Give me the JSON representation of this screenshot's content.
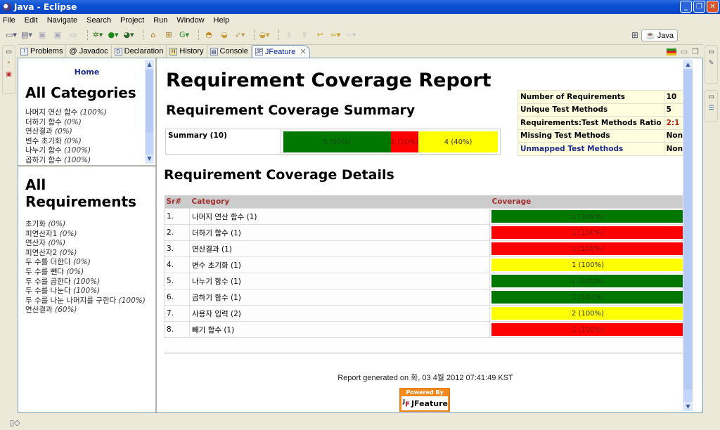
{
  "window": {
    "title": "Java - Eclipse"
  },
  "menu": [
    "File",
    "Edit",
    "Navigate",
    "Search",
    "Project",
    "Run",
    "Window",
    "Help"
  ],
  "perspective": {
    "label": "Java"
  },
  "tabs": [
    {
      "label": "Problems",
      "icon": "problems-icon",
      "active": false
    },
    {
      "label": "@ Javadoc",
      "icon": "javadoc-icon",
      "active": false
    },
    {
      "label": "Declaration",
      "icon": "declaration-icon",
      "active": false
    },
    {
      "label": "History",
      "icon": "history-icon",
      "active": false
    },
    {
      "label": "Console",
      "icon": "console-icon",
      "active": false
    },
    {
      "label": "JFeature",
      "icon": "jfeature-icon",
      "active": true
    }
  ],
  "sidebar": {
    "home_label": "Home",
    "categories_title": "All Categories",
    "categories": [
      {
        "name": "나머지 연산 함수",
        "pct": "(100%)"
      },
      {
        "name": "더하기 함수",
        "pct": "(0%)"
      },
      {
        "name": "연산결과",
        "pct": "(0%)"
      },
      {
        "name": "변수 초기화",
        "pct": "(0%)"
      },
      {
        "name": "나누기 함수",
        "pct": "(100%)"
      },
      {
        "name": "곱하기 함수",
        "pct": "(100%)"
      }
    ],
    "requirements_title_1": "All",
    "requirements_title_2": "Requirements",
    "requirements": [
      {
        "name": "초기화",
        "pct": "(0%)"
      },
      {
        "name": "피연산자1",
        "pct": "(0%)"
      },
      {
        "name": "연산자",
        "pct": "(0%)"
      },
      {
        "name": "피연산자2",
        "pct": "(0%)"
      },
      {
        "name": "두 수를 더한다",
        "pct": "(0%)"
      },
      {
        "name": "두 수를 뺀다",
        "pct": "(0%)"
      },
      {
        "name": "두 수를 곱한다",
        "pct": "(100%)"
      },
      {
        "name": "두 수를 나눈다",
        "pct": "(100%)"
      },
      {
        "name": "두 수를 나눈 나머지를 구한다",
        "pct": "(100%)"
      },
      {
        "name": "연산결과",
        "pct": "(60%)"
      }
    ]
  },
  "report": {
    "title": "Requirement Coverage Report",
    "summary_title": "Requirement Coverage Summary",
    "summary_label": "Summary (10)",
    "summary_segments": [
      {
        "label": "5 (50%)",
        "fraction": 0.5,
        "color": "#007700",
        "text_color": "#0a4a0a"
      },
      {
        "label": "1 (10%)",
        "fraction": 0.13,
        "color": "#ff0000",
        "text_color": "#8a0000"
      },
      {
        "label": "4 (40%)",
        "fraction": 0.37,
        "color": "#ffff00",
        "text_color": "#333333"
      }
    ],
    "stats": [
      {
        "label": "Number of Requirements",
        "value": "10",
        "label_color": "#000000",
        "value_color": "#000000"
      },
      {
        "label": "Unique Test Methods",
        "value": "5",
        "label_color": "#000000",
        "value_color": "#000000"
      },
      {
        "label": "Requirements:Test Methods Ratio",
        "value": "2:1",
        "label_color": "#000000",
        "value_color": "#b02a1a"
      },
      {
        "label": "Missing Test Methods",
        "value": "None",
        "label_color": "#000000",
        "value_color": "#000000"
      },
      {
        "label": "Unmapped Test Methods",
        "value": "None",
        "label_color": "#1c2a8c",
        "value_color": "#000000"
      }
    ],
    "details_title": "Requirement Coverage Details",
    "columns": {
      "sr": "Sr#",
      "category": "Category",
      "coverage": "Coverage"
    },
    "rows": [
      {
        "sr": "1.",
        "category": "나머지 연산 함수 (1)",
        "coverage": "1 (100%)",
        "status": "green"
      },
      {
        "sr": "2.",
        "category": "더하기 함수 (1)",
        "coverage": "1 (100%)",
        "status": "red"
      },
      {
        "sr": "3.",
        "category": "연산결과 (1)",
        "coverage": "1 (100%)",
        "status": "red"
      },
      {
        "sr": "4.",
        "category": "변수 초기화 (1)",
        "coverage": "1 (100%)",
        "status": "yellow"
      },
      {
        "sr": "5.",
        "category": "나누기 함수 (1)",
        "coverage": "1 (100%)",
        "status": "green"
      },
      {
        "sr": "6.",
        "category": "곱하기 함수 (1)",
        "coverage": "1 (100%)",
        "status": "green"
      },
      {
        "sr": "7.",
        "category": "사용자 입력 (2)",
        "coverage": "2 (100%)",
        "status": "yellow"
      },
      {
        "sr": "8.",
        "category": "빼기 함수 (1)",
        "coverage": "1 (100%)",
        "status": "red"
      }
    ],
    "status_colors": {
      "green": "#007700",
      "red": "#ff0000",
      "yellow": "#ffff00"
    },
    "status_text_colors": {
      "green": "#0a4a0a",
      "red": "#8a0000",
      "yellow": "#333333"
    },
    "footer": "Report generated on 화, 03 4월 2012 07:41:49 KST",
    "powered_by": "Powered By",
    "brand": "JFeature"
  }
}
